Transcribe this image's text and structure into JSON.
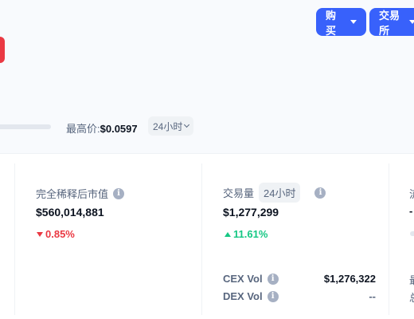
{
  "header": {
    "buy_label": "购买",
    "exchange_label": "交易所"
  },
  "price_range": {
    "high_label": "最高价:",
    "high_value": "$0.0597",
    "period": "24小时"
  },
  "stats": {
    "fdv": {
      "title": "完全稀释后市值",
      "value": "$560,014,881",
      "change": "0.85%",
      "direction": "down"
    },
    "volume": {
      "title": "交易量",
      "period": "24小时",
      "value": "$1,277,299",
      "change": "11.61%",
      "direction": "up",
      "cex_label": "CEX Vol",
      "cex_value": "$1,276,322",
      "dex_label": "DEX Vol",
      "dex_value": "--"
    },
    "partial": {
      "title_fragment": "流",
      "value_fragment": "-",
      "sub1_fragment": "最",
      "sub2_fragment": "总"
    }
  },
  "colors": {
    "accent": "#3861fb",
    "negative": "#ea3943",
    "positive": "#16c784"
  }
}
